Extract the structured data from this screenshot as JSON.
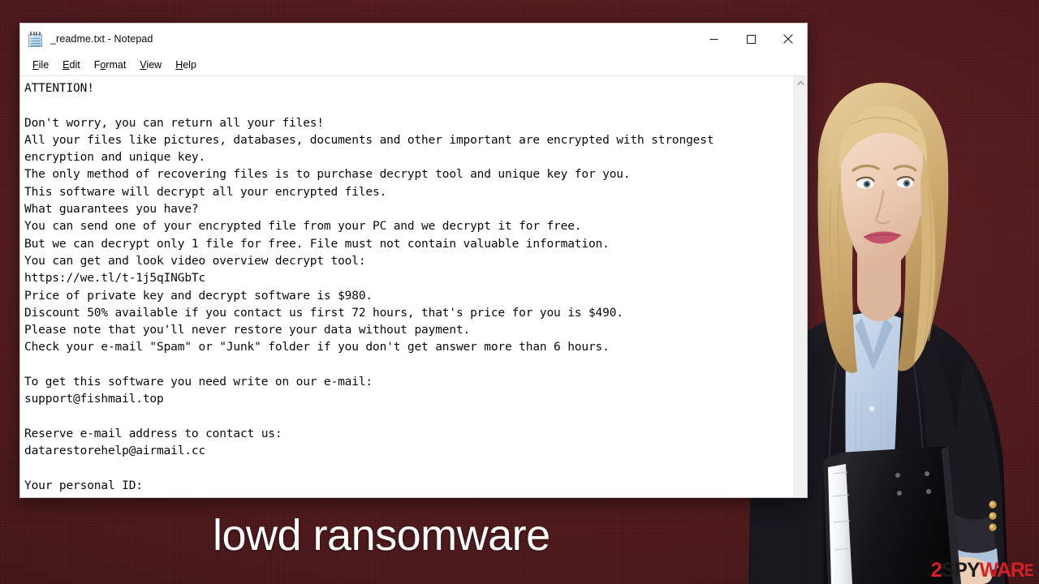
{
  "window": {
    "title": "_readme.txt - Notepad",
    "icon": "notepad-icon",
    "controls": {
      "minimize": "minimize-button",
      "maximize": "maximize-button",
      "close": "close-button"
    },
    "menu": [
      {
        "label": "File",
        "accel": "F"
      },
      {
        "label": "Edit",
        "accel": "E"
      },
      {
        "label": "Format",
        "accel": "o"
      },
      {
        "label": "View",
        "accel": "V"
      },
      {
        "label": "Help",
        "accel": "H"
      }
    ]
  },
  "ransom_note": {
    "lines": [
      "ATTENTION!",
      "",
      "Don't worry, you can return all your files!",
      "All your files like pictures, databases, documents and other important are encrypted with strongest",
      "encryption and unique key.",
      "The only method of recovering files is to purchase decrypt tool and unique key for you.",
      "This software will decrypt all your encrypted files.",
      "What guarantees you have?",
      "You can send one of your encrypted file from your PC and we decrypt it for free.",
      "But we can decrypt only 1 file for free. File must not contain valuable information.",
      "You can get and look video overview decrypt tool:",
      "https://we.tl/t-1j5qINGbTc",
      "Price of private key and decrypt software is $980.",
      "Discount 50% available if you contact us first 72 hours, that's price for you is $490.",
      "Please note that you'll never restore your data without payment.",
      "Check your e-mail \"Spam\" or \"Junk\" folder if you don't get answer more than 6 hours.",
      "",
      "To get this software you need write on our e-mail:",
      "support@fishmail.top",
      "",
      "Reserve e-mail address to contact us:",
      "datarestorehelp@airmail.cc",
      "",
      "Your personal ID:"
    ],
    "video_url": "https://we.tl/t-1j5qINGbTc",
    "price_full": "$980",
    "price_discount": "$490",
    "discount_percent": "50%",
    "discount_window_hours": "72",
    "response_time_hours": "6",
    "primary_email": "support@fishmail.top",
    "reserve_email": "datarestorehelp@airmail.cc"
  },
  "caption": {
    "text": "lowd ransomware"
  },
  "watermark": {
    "part1": "2",
    "part2": "SPY",
    "part3": "WAR",
    "part4": "E"
  },
  "colors": {
    "background_red": "#4a1418",
    "window_white": "#ffffff",
    "caption_white": "#ffffff",
    "watermark_red": "#d81f26",
    "watermark_dark": "#1b1b1b"
  },
  "scrollbar": {
    "up_arrow": "chevron-up-icon"
  }
}
